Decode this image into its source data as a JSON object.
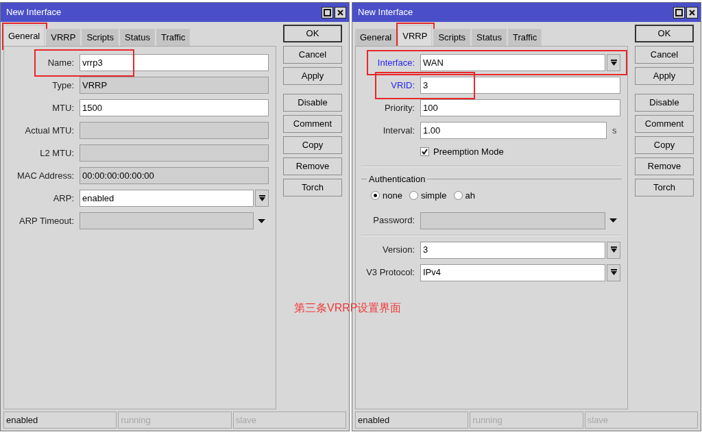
{
  "windows": [
    {
      "title": "New Interface",
      "tabs": [
        {
          "label": "General",
          "selected": true,
          "marked": true
        },
        {
          "label": "VRRP",
          "selected": false,
          "marked": false
        },
        {
          "label": "Scripts",
          "selected": false,
          "marked": false
        },
        {
          "label": "Status",
          "selected": false,
          "marked": false
        },
        {
          "label": "Traffic",
          "selected": false,
          "marked": false
        }
      ],
      "fields": [
        {
          "kind": "text",
          "label": "Name:",
          "value": "vrrp3",
          "required": false,
          "marked": true
        },
        {
          "kind": "readonly",
          "label": "Type:",
          "value": "VRRP",
          "required": false,
          "marked": false
        },
        {
          "kind": "text",
          "label": "MTU:",
          "value": "1500",
          "required": false,
          "marked": false
        },
        {
          "kind": "readonly",
          "label": "Actual MTU:",
          "required": false,
          "marked": false
        },
        {
          "kind": "readonly",
          "label": "L2 MTU:",
          "required": false,
          "marked": false
        },
        {
          "kind": "readonly",
          "label": "MAC Address:",
          "value": "00:00:00:00:00:00",
          "required": false,
          "marked": false
        },
        {
          "kind": "dropdown",
          "label": "ARP:",
          "value": "enabled",
          "required": false,
          "marked": false
        },
        {
          "kind": "dropdown-off",
          "label": "ARP Timeout:",
          "required": false,
          "marked": false
        }
      ],
      "button_groups": [
        [
          {
            "label": "OK",
            "default": true
          },
          {
            "label": "Cancel",
            "default": false
          },
          {
            "label": "Apply",
            "default": false
          }
        ],
        [
          {
            "label": "Disable",
            "default": false
          },
          {
            "label": "Comment",
            "default": false
          },
          {
            "label": "Copy",
            "default": false
          },
          {
            "label": "Remove",
            "default": false
          },
          {
            "label": "Torch",
            "default": false
          }
        ]
      ],
      "status": [
        {
          "text": "enabled",
          "disabled": false
        },
        {
          "text": "running",
          "disabled": true
        },
        {
          "text": "slave",
          "disabled": true
        }
      ]
    },
    {
      "title": "New Interface",
      "tabs": [
        {
          "label": "General",
          "selected": false,
          "marked": false
        },
        {
          "label": "VRRP",
          "selected": true,
          "marked": true
        },
        {
          "label": "Scripts",
          "selected": false,
          "marked": false
        },
        {
          "label": "Status",
          "selected": false,
          "marked": false
        },
        {
          "label": "Traffic",
          "selected": false,
          "marked": false
        }
      ],
      "fields": [
        {
          "kind": "dropdown",
          "label": "Interface:",
          "value": "WAN",
          "required": true,
          "marked": true
        },
        {
          "kind": "text",
          "label": "VRID:",
          "value": "3",
          "required": true,
          "marked": true
        },
        {
          "kind": "text",
          "label": "Priority:",
          "value": "100",
          "required": false,
          "marked": false
        },
        {
          "kind": "text",
          "label": "Interval:",
          "value": "1.00",
          "unit": "s",
          "required": false,
          "marked": false
        },
        {
          "kind": "checkbox",
          "label": "Preemption Mode",
          "checked": true
        },
        {
          "kind": "divider"
        },
        {
          "kind": "radio-group",
          "title": "Authentication",
          "options": [
            {
              "label": "none",
              "selected": true
            },
            {
              "label": "simple",
              "selected": false
            },
            {
              "label": "ah",
              "selected": false
            }
          ]
        },
        {
          "kind": "dropdown-off",
          "label": "Password:",
          "required": false,
          "marked": false
        },
        {
          "kind": "divider"
        },
        {
          "kind": "dropdown",
          "label": "Version:",
          "value": "3",
          "required": false,
          "marked": false
        },
        {
          "kind": "dropdown",
          "label": "V3 Protocol:",
          "value": "IPv4",
          "required": false,
          "marked": false
        }
      ],
      "button_groups": [
        [
          {
            "label": "OK",
            "default": true
          },
          {
            "label": "Cancel",
            "default": false
          },
          {
            "label": "Apply",
            "default": false
          }
        ],
        [
          {
            "label": "Disable",
            "default": false
          },
          {
            "label": "Comment",
            "default": false
          },
          {
            "label": "Copy",
            "default": false
          },
          {
            "label": "Remove",
            "default": false
          },
          {
            "label": "Torch",
            "default": false
          }
        ]
      ],
      "annotation": "第三条VRRP设置界面",
      "status": [
        {
          "text": "enabled",
          "disabled": false
        },
        {
          "text": "running",
          "disabled": true
        },
        {
          "text": "slave",
          "disabled": true
        }
      ]
    }
  ]
}
